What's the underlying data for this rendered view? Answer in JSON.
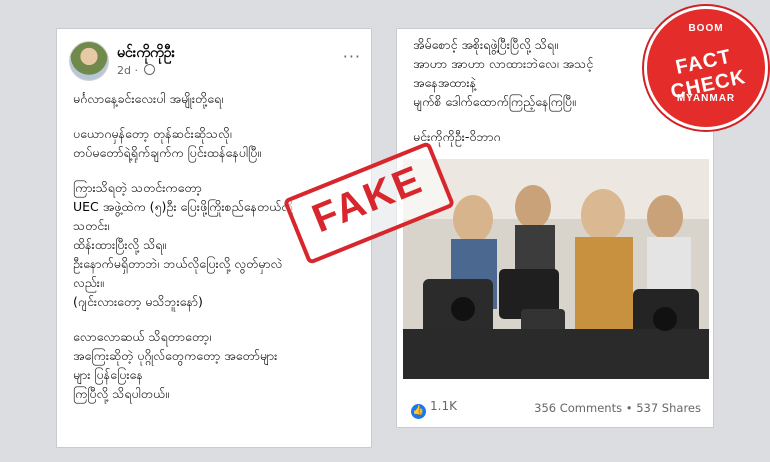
{
  "post": {
    "author": "မင်းကိုကိုဦး",
    "time": "2d",
    "body_lines": [
      "မင်္ဂလာနေ့ခင်းလေးပါ အမျိုးတို့ရေ၊",
      "",
      "ပယောဂမှန်တော့ တုန်ဆင်းဆိုသလို၊",
      "တပ်မတော်ရဲ့ရိုက်ချက်က ပြင်းထန်နေပါပြီ။",
      "",
      "ကြားသိရတဲ့ သတင်းကတော့",
      "UEC အဖွဲ့ထဲက (၅)ဦး ပြေးဖို့ကြိုးစည်နေတယ်လို့",
      "သတင်း၊",
      "ထိန်းထားပြီးလို့ သိရ။",
      "ဦးနောက်မရှိတာဘဲ၊ ဘယ်လိုပြေးလို့ လွတ်မှာလဲ",
      "လည်း။",
      "(ဂျင်းလားတော့ မသိဘူးနော်)",
      "",
      "လောလောဆယ် သိရတာတော့၊",
      "အကြေးဆိုတဲ့ ပုဂ္ဂိုလ်တွေကတော့ အတော်များ",
      "များ ပြန်ပြေးနေ",
      "ကြပြီလို့ သိရပါတယ်။"
    ],
    "continued_lines": [
      "အိမ်စောင့် အစိုးရဖွဲ့ပြီးပြီလို့ သိရ။",
      "အာဟာ အာဟာ လာထားဘဲလေ၊ အသင့်",
      "အနေအထားနဲ့",
      "မျက်စိ ဒေါက်ထောက်ကြည့်နေကြပြီ။",
      "",
      "မင်းကိုကိုဦး-ဝိဘာဂ"
    ],
    "reactions_count": "1.1K",
    "comments": "356 Comments",
    "shares": "537 Shares"
  },
  "stamp": {
    "text": "FAKE"
  },
  "badge": {
    "top": "BOOM",
    "main": "FACT CHECK",
    "bottom": "MYANMAR"
  },
  "colors": {
    "stamp_red": "#d8262d",
    "badge_red": "#e42c2a",
    "like_blue": "#1877f2"
  }
}
